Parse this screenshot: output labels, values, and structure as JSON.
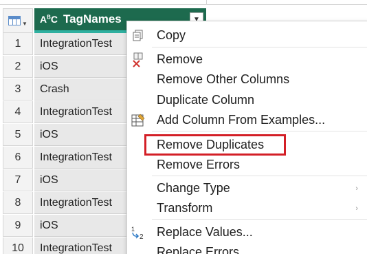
{
  "column": {
    "type_icon": "ABC",
    "type_icon_name": "text-type-icon",
    "name": "TagNames",
    "dropdown_icon": "chevron-down-icon"
  },
  "rows": [
    {
      "num": "1",
      "value": "IntegrationTest"
    },
    {
      "num": "2",
      "value": "iOS"
    },
    {
      "num": "3",
      "value": "Crash"
    },
    {
      "num": "4",
      "value": "IntegrationTest"
    },
    {
      "num": "5",
      "value": "iOS"
    },
    {
      "num": "6",
      "value": "IntegrationTest"
    },
    {
      "num": "7",
      "value": "iOS"
    },
    {
      "num": "8",
      "value": "IntegrationTest"
    },
    {
      "num": "9",
      "value": "iOS"
    },
    {
      "num": "10",
      "value": "IntegrationTest"
    }
  ],
  "menu": {
    "items": [
      {
        "label": "Copy",
        "icon": "copy-icon"
      },
      {
        "label": "Remove",
        "icon": "remove-column-icon"
      },
      {
        "label": "Remove Other Columns"
      },
      {
        "label": "Duplicate Column"
      },
      {
        "label": "Add Column From Examples...",
        "icon": "column-from-examples-icon"
      },
      {
        "label": "Remove Duplicates",
        "highlighted": true
      },
      {
        "label": "Remove Errors"
      },
      {
        "label": "Change Type",
        "submenu": true
      },
      {
        "label": "Transform",
        "submenu": true
      },
      {
        "label": "Replace Values...",
        "icon": "replace-values-icon"
      },
      {
        "label": "Replace Errors"
      }
    ],
    "highlight_color": "#d31f26"
  },
  "colors": {
    "header_bg": "#1d6a4e",
    "header_underline": "#2fb0a0",
    "cell_bg": "#e8e8e8"
  }
}
